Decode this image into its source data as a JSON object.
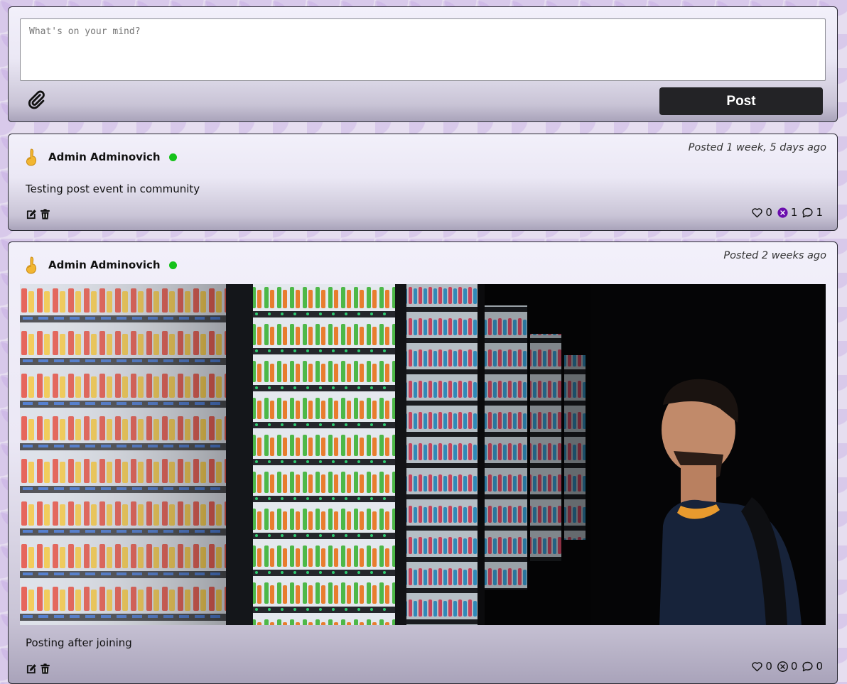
{
  "composer": {
    "placeholder": "What's on your mind?",
    "post_label": "Post"
  },
  "posts": [
    {
      "author": "Admin Adminovich",
      "timestamp": "Posted 1 week, 5 days ago",
      "text": "Testing post event in community",
      "likes": "0",
      "dislikes": "1",
      "comments": "1",
      "dislike_active": true
    },
    {
      "author": "Admin Adminovich",
      "timestamp": "Posted 2 weeks ago",
      "text": "Posting after joining",
      "image": "photo of a man looking at illuminated vending machines",
      "likes": "0",
      "dislikes": "0",
      "comments": "0",
      "dislike_active": false
    }
  ],
  "colors": {
    "online": "#15c21a",
    "dislike_active": "#6a0dad",
    "post_button": "#232326"
  }
}
